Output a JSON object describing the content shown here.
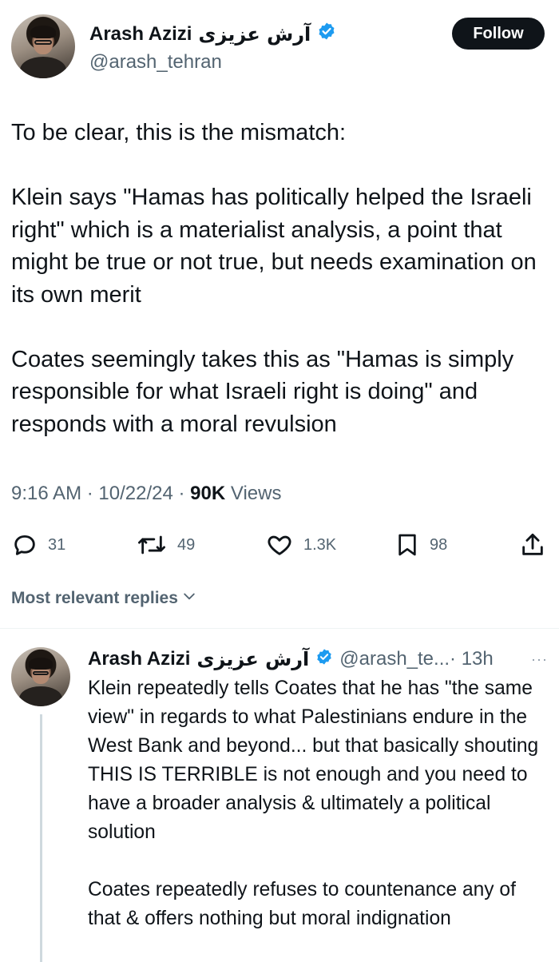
{
  "tweet": {
    "author_name": "Arash Azizi",
    "author_name_fa": "آرش عزیزی",
    "handle": "@arash_tehran",
    "follow_label": "Follow",
    "paragraphs": [
      "To be clear, this is the mismatch:",
      "Klein says \"Hamas has politically helped the Israeli right\" which is a materialist analysis, a point that might be true or not true, but needs examination on its own merit",
      "Coates seemingly takes this as \"Hamas is simply responsible for what Israeli right is doing\" and responds with a moral revulsion"
    ],
    "time": "9:16 AM",
    "date": "10/22/24",
    "views_count": "90K",
    "views_label": "Views",
    "separator": "·",
    "actions": {
      "replies": "31",
      "reposts": "49",
      "likes": "1.3K",
      "bookmarks": "98"
    },
    "verified_color": "#1d9bf0"
  },
  "sort": {
    "label": "Most relevant replies"
  },
  "reply": {
    "author_name": "Arash Azizi",
    "author_name_fa": "آرش عزیزی",
    "handle": "@arash_te...",
    "time": "· 13h",
    "more": "···",
    "paragraphs": [
      "Klein repeatedly tells Coates that he has \"the same view\" in regards to what Palestinians endure in the West Bank and beyond... but that basically shouting THIS IS TERRIBLE is not enough and you need to have a broader analysis & ultimately a political solution",
      "Coates repeatedly refuses to countenance any of that & offers nothing but moral indignation"
    ]
  },
  "icons": {
    "reply": "reply-icon",
    "repost": "repost-icon",
    "like": "heart-icon",
    "bookmark": "bookmark-icon",
    "share": "share-icon",
    "verified": "verified-badge-icon",
    "chevron": "chevron-down-icon",
    "more": "more-icon"
  }
}
